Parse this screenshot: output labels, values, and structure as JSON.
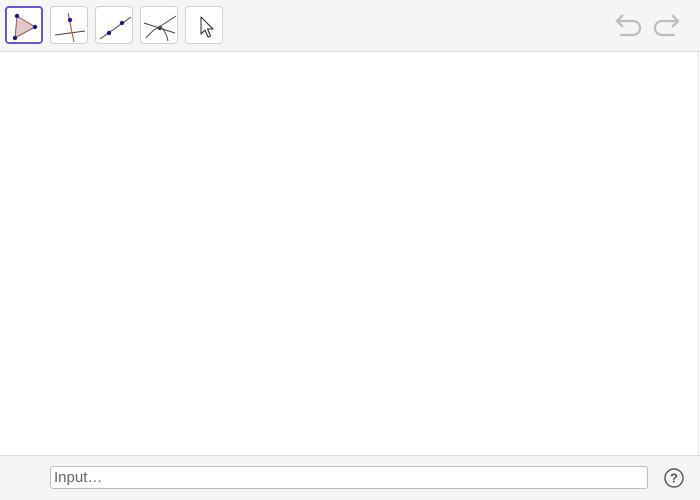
{
  "toolbar": {
    "tools": [
      {
        "icon": "polygon-icon",
        "selected": true
      },
      {
        "icon": "perpendicular-line-icon",
        "selected": false
      },
      {
        "icon": "line-through-two-points-icon",
        "selected": false
      },
      {
        "icon": "intersect-icon",
        "selected": false
      },
      {
        "icon": "move-arrow-icon",
        "selected": false
      }
    ],
    "undo_icon": "undo-icon",
    "redo_icon": "redo-icon"
  },
  "input_bar": {
    "placeholder": "Input…",
    "value": "",
    "help_glyph": "?"
  },
  "colors": {
    "selected_border": "#6557d2",
    "point": "#1a1a8c",
    "polygon_fill": "#e2c8c8",
    "polygon_stroke": "#8c5a5a",
    "perpendicular": "#c0461e",
    "disabled_icon": "#bdbdbd"
  }
}
